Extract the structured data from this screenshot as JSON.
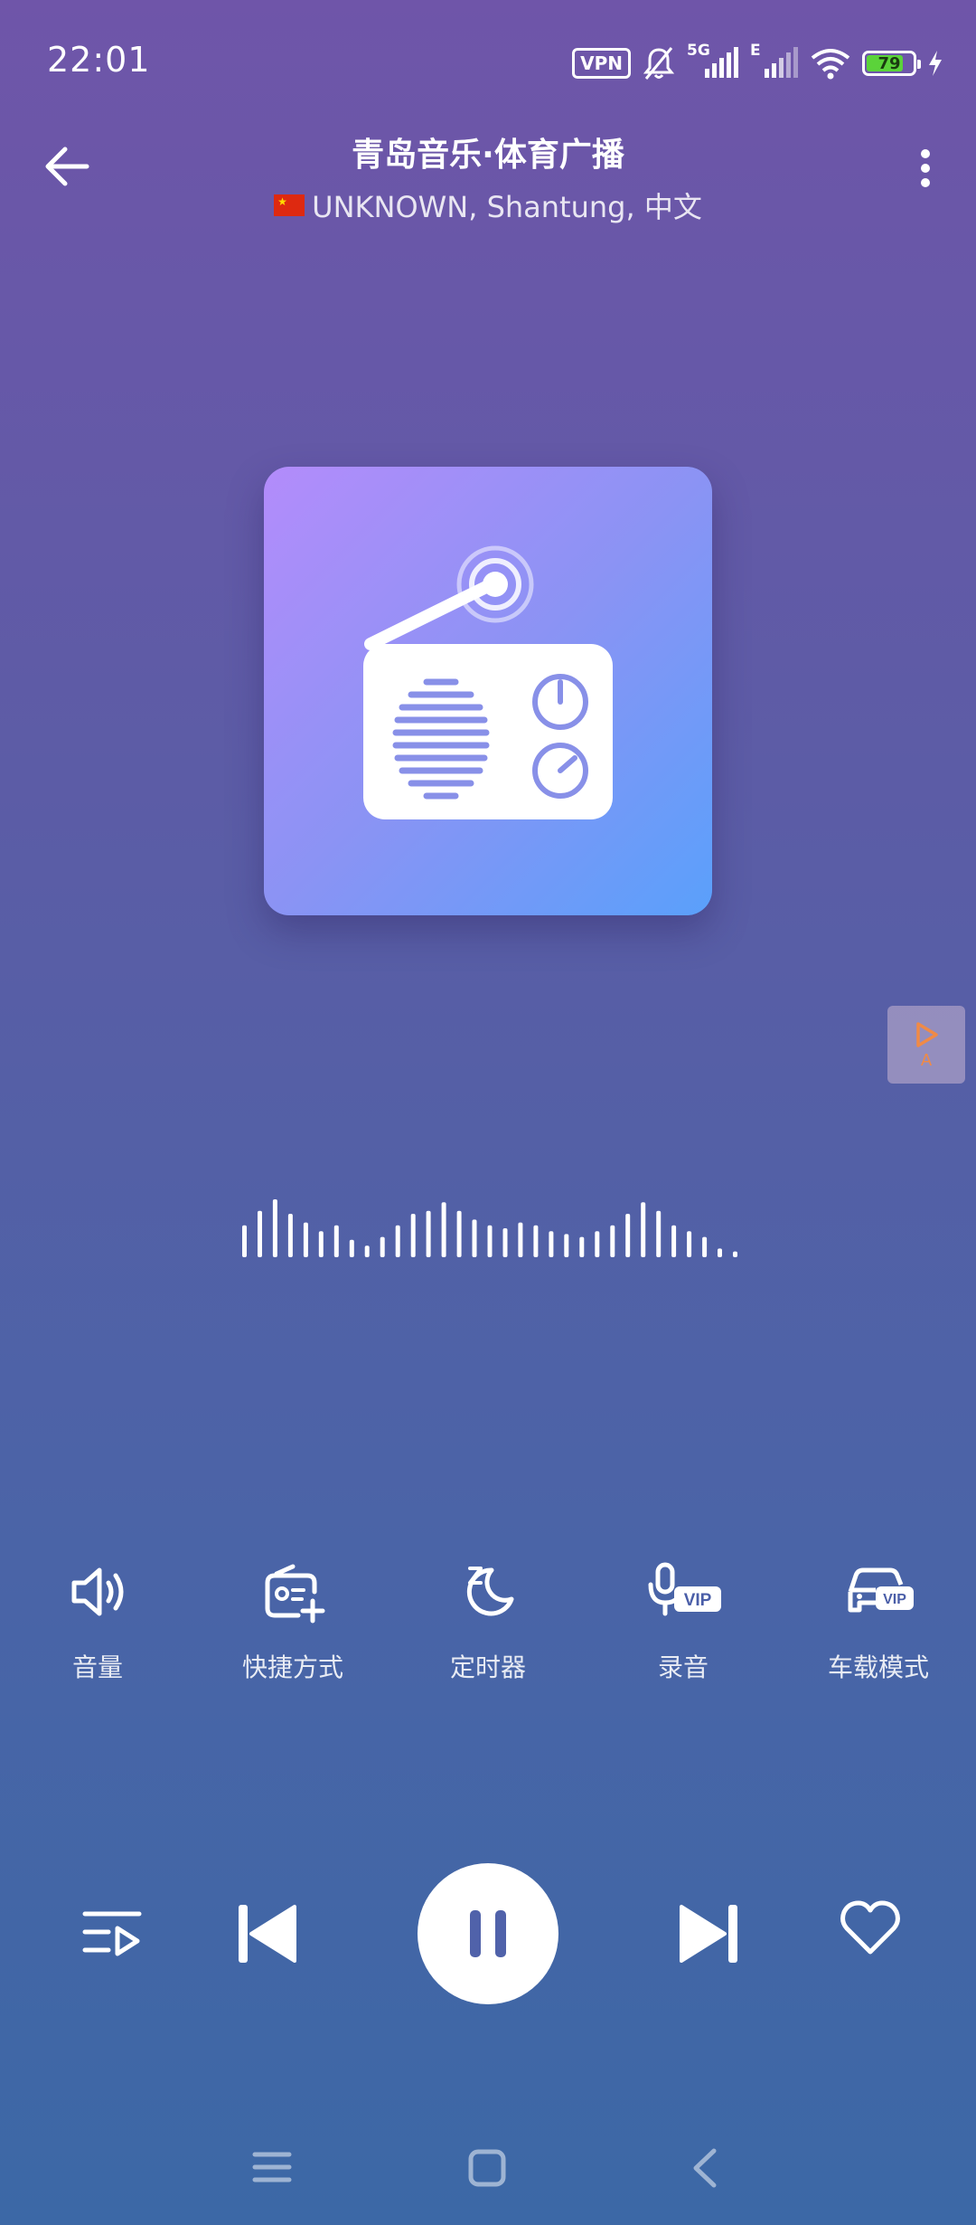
{
  "status_bar": {
    "time": "22:01",
    "vpn_label": "VPN",
    "network_5g": "5G",
    "network_e": "E",
    "battery_level": "79",
    "battery_fraction": 0.79,
    "battery_color": "#5bd33a"
  },
  "header": {
    "title": "青岛音乐·体育广播",
    "subtitle": "UNKNOWN, Shantung, 中文"
  },
  "side_badge": {
    "letter": "A",
    "accent_color": "#f08a46"
  },
  "artwork": {
    "icon": "radio-icon",
    "gradient_start": "#b38cfb",
    "gradient_end": "#5aa0fb"
  },
  "waveform": {
    "levels": [
      0.55,
      0.8,
      1.0,
      0.75,
      0.6,
      0.45,
      0.55,
      0.3,
      0.2,
      0.35,
      0.55,
      0.75,
      0.8,
      0.95,
      0.8,
      0.65,
      0.55,
      0.5,
      0.6,
      0.55,
      0.45,
      0.4,
      0.35,
      0.45,
      0.55,
      0.75,
      0.95,
      0.8,
      0.55,
      0.45,
      0.35,
      0.15,
      0.1
    ]
  },
  "actions": [
    {
      "label": "音量",
      "icon": "volume-icon"
    },
    {
      "label": "快捷方式",
      "icon": "shortcut-radio-icon"
    },
    {
      "label": "定时器",
      "icon": "sleep-timer-icon"
    },
    {
      "label": "录音",
      "icon": "record-vip-icon"
    },
    {
      "label": "车载模式",
      "icon": "car-mode-vip-icon"
    }
  ],
  "vip_badge": "VIP",
  "controls": {
    "playlist": "playlist-icon",
    "previous": "skip-previous-icon",
    "play_state": "pause-icon",
    "next": "skip-next-icon",
    "favorite": "heart-outline-icon"
  },
  "nav": {
    "menu": "menu-icon",
    "home": "home-square-icon",
    "back": "back-chevron-icon"
  }
}
